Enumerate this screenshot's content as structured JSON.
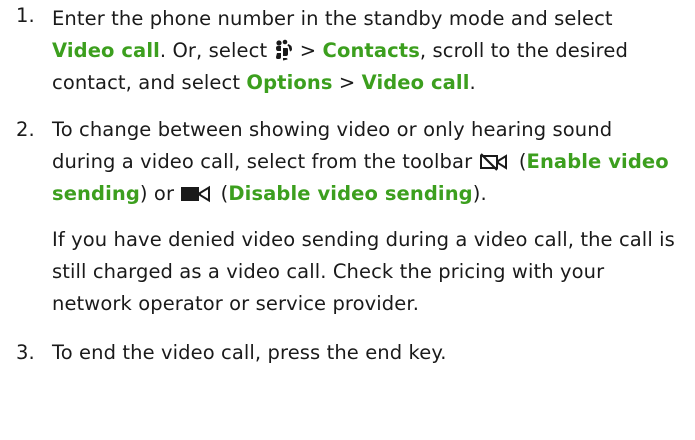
{
  "steps": [
    {
      "number": "1.",
      "t1": "Enter the phone number in the standby mode and select ",
      "h1": "Video call",
      "t2": ". Or, select ",
      "icon": "menu-key-icon",
      "t3": " > ",
      "h2": "Contacts",
      "t4": ", scroll to the desired contact, and select ",
      "h3": "Options",
      "t5": " > ",
      "h4": "Video call",
      "t6": "."
    },
    {
      "number": "2.",
      "t1": "To change between showing video or only hearing sound during a video call, select from the toolbar ",
      "icon1": "enable-video-sending-icon",
      "t2": " (",
      "h1": "Enable video sending",
      "t3": ") or ",
      "icon2": "disable-video-sending-icon",
      "t4": " (",
      "h2": "Disable video sending",
      "t5": ").",
      "note": "If you have denied video sending during a video call, the call is still charged as a video call. Check the pricing with your network operator or service provider."
    },
    {
      "number": "3.",
      "t1": "To end the video call, press the end key."
    }
  ],
  "colors": {
    "text": "#1a1a1a",
    "highlight": "#3c9f1e"
  }
}
